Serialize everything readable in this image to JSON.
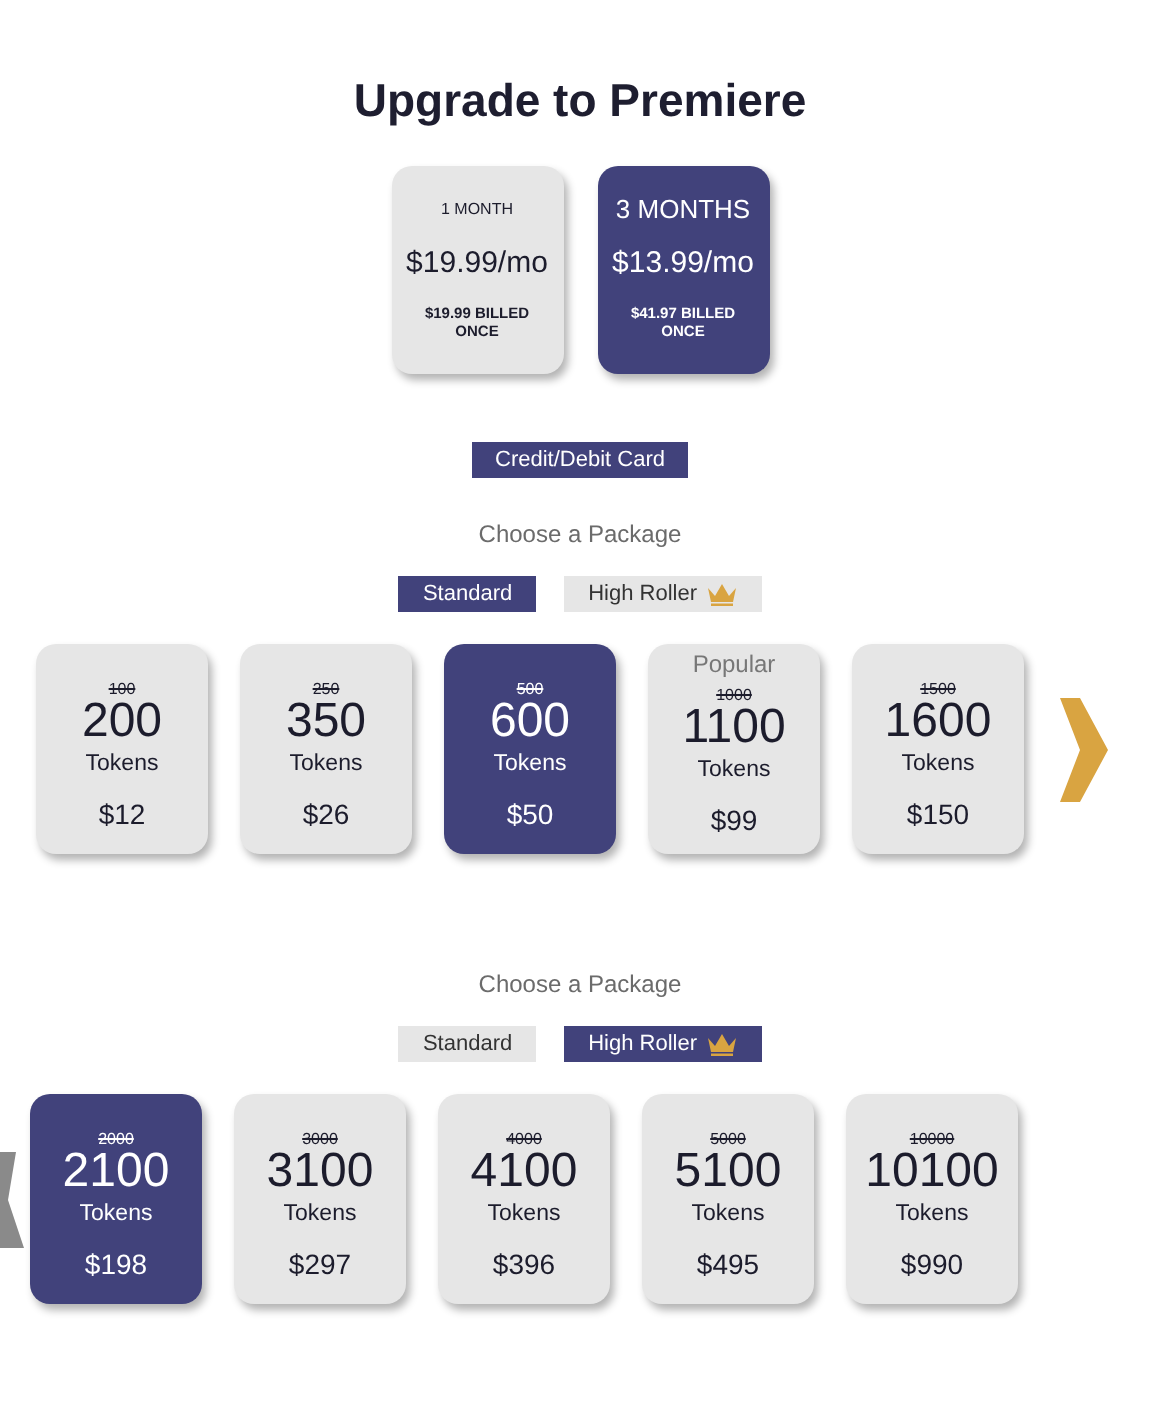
{
  "title": "Upgrade to Premiere",
  "plans": [
    {
      "period": "1 MONTH",
      "price": "$19.99/mo",
      "billed": "$19.99 BILLED ONCE",
      "selected": false
    },
    {
      "period": "3 MONTHS",
      "price": "$13.99/mo",
      "billed": "$41.97 BILLED ONCE",
      "selected": true
    }
  ],
  "payment_button": "Credit/Debit Card",
  "packages": [
    {
      "heading": "Choose a Package",
      "tabs": [
        {
          "label": "Standard",
          "selected": true,
          "crown": false
        },
        {
          "label": "High Roller",
          "selected": false,
          "crown": true
        }
      ],
      "nav_arrow": {
        "kind": "next"
      },
      "cards": [
        {
          "old": "100",
          "amount": "200",
          "unit": "Tokens",
          "price": "$12",
          "selected": false
        },
        {
          "old": "250",
          "amount": "350",
          "unit": "Tokens",
          "price": "$26",
          "selected": false
        },
        {
          "old": "500",
          "amount": "600",
          "unit": "Tokens",
          "price": "$50",
          "selected": true
        },
        {
          "badge": "Popular",
          "old": "1000",
          "amount": "1100",
          "unit": "Tokens",
          "price": "$99",
          "selected": false
        },
        {
          "old": "1500",
          "amount": "1600",
          "unit": "Tokens",
          "price": "$150",
          "selected": false
        }
      ]
    },
    {
      "heading": "Choose a Package",
      "tabs": [
        {
          "label": "Standard",
          "selected": false,
          "crown": false
        },
        {
          "label": "High Roller",
          "selected": true,
          "crown": true
        }
      ],
      "nav_arrow": {
        "kind": "prev"
      },
      "cards": [
        {
          "old": "2000",
          "amount": "2100",
          "unit": "Tokens",
          "price": "$198",
          "selected": true
        },
        {
          "old": "3000",
          "amount": "3100",
          "unit": "Tokens",
          "price": "$297",
          "selected": false
        },
        {
          "old": "4000",
          "amount": "4100",
          "unit": "Tokens",
          "price": "$396",
          "selected": false
        },
        {
          "old": "5000",
          "amount": "5100",
          "unit": "Tokens",
          "price": "$495",
          "selected": false
        },
        {
          "old": "10000",
          "amount": "10100",
          "unit": "Tokens",
          "price": "$990",
          "selected": false
        }
      ]
    }
  ]
}
